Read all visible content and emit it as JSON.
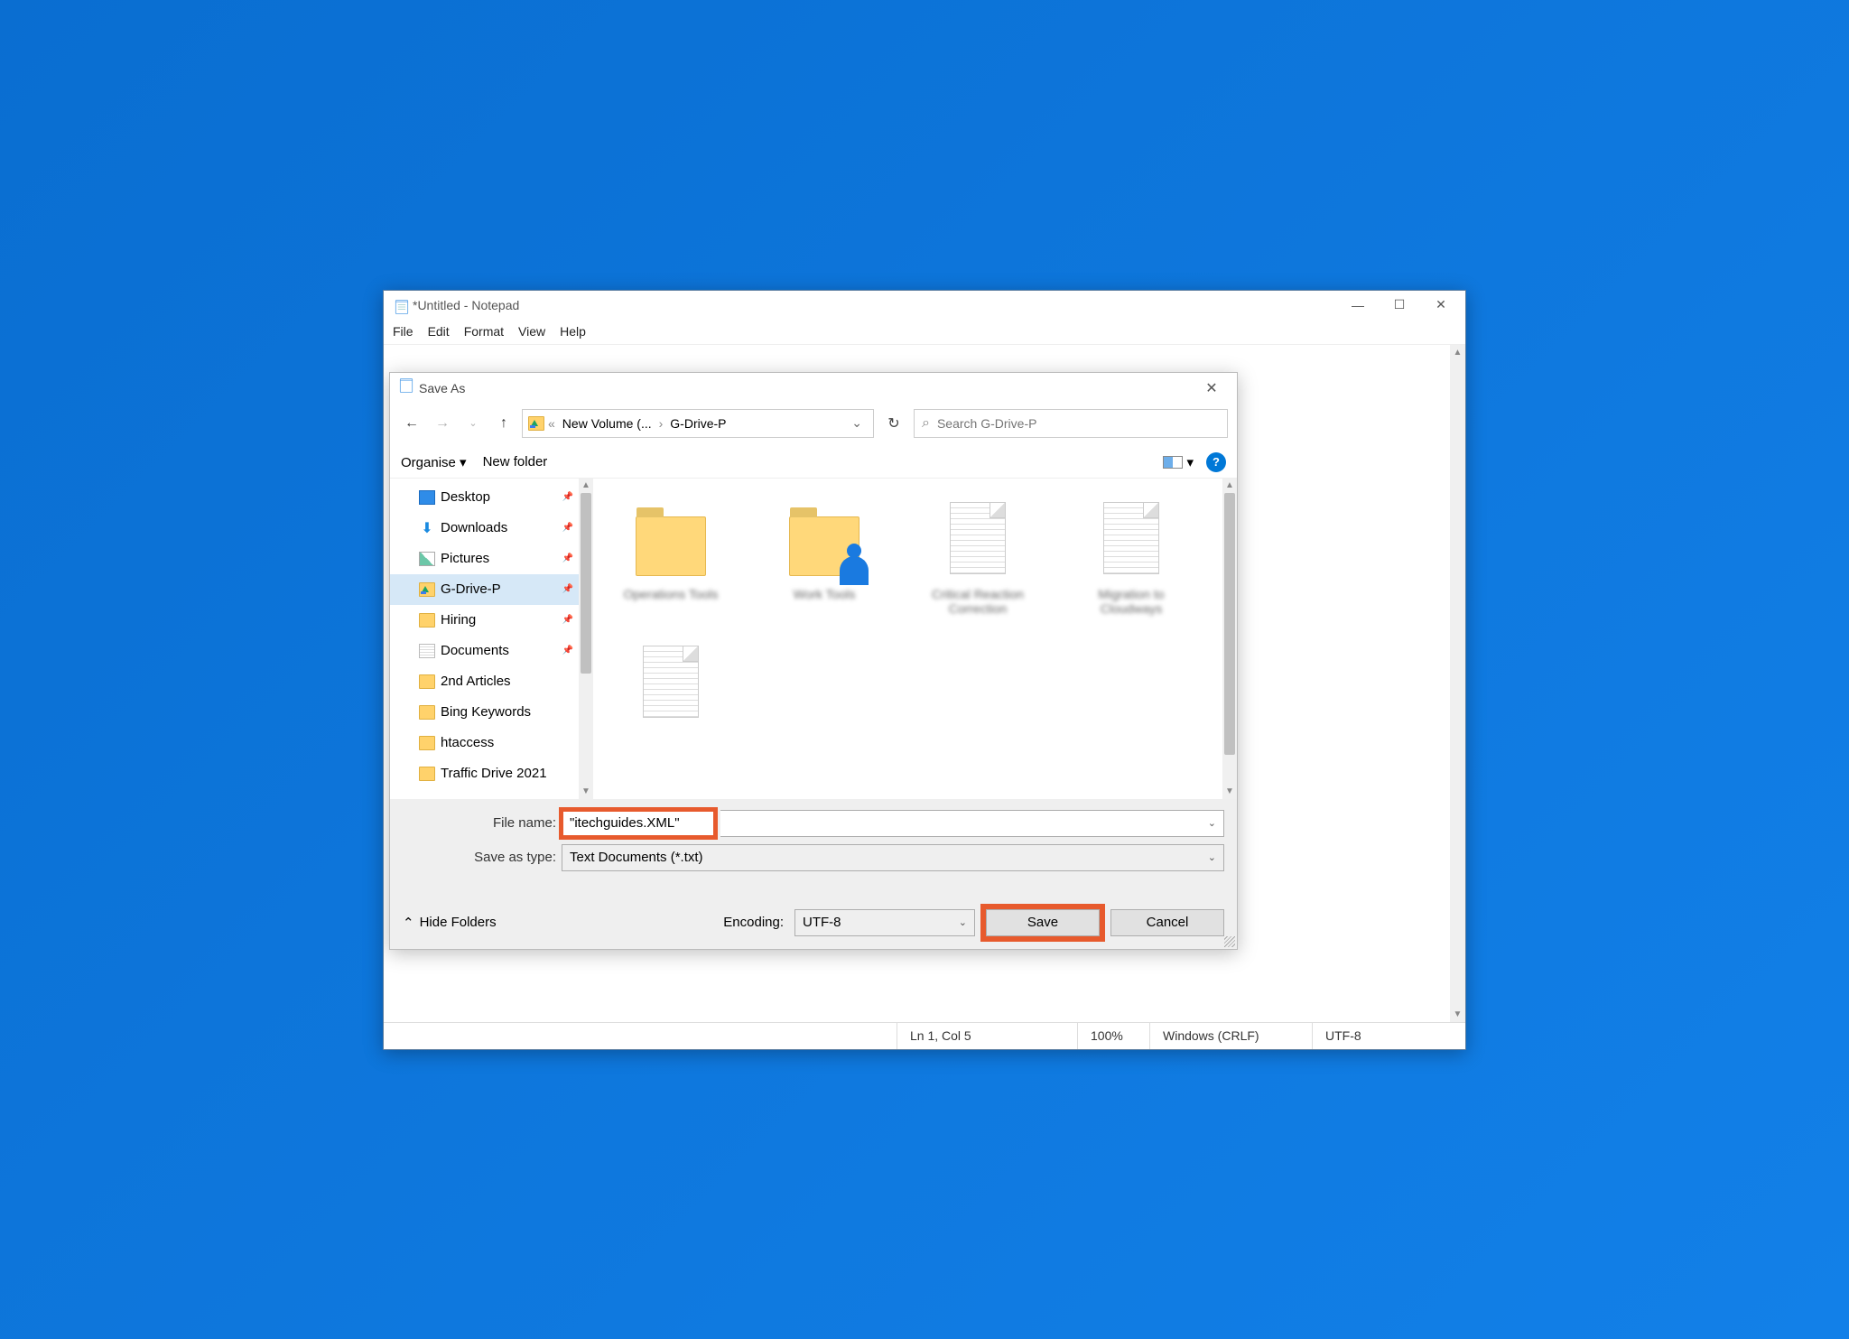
{
  "window": {
    "title": "*Untitled - Notepad",
    "menu": {
      "file": "File",
      "edit": "Edit",
      "format": "Format",
      "view": "View",
      "help": "Help"
    }
  },
  "dialog": {
    "title": "Save As",
    "breadcrumb": {
      "seg1": "New Volume (...",
      "seg2": "G-Drive-P"
    },
    "search_placeholder": "Search G-Drive-P",
    "toolbar": {
      "organise": "Organise",
      "new_folder": "New folder"
    },
    "tree": {
      "desktop": "Desktop",
      "downloads": "Downloads",
      "pictures": "Pictures",
      "gdrivep": "G-Drive-P",
      "hiring": "Hiring",
      "documents": "Documents",
      "second_articles": "2nd Articles",
      "bing_keywords": "Bing Keywords",
      "htaccess": "htaccess",
      "traffic_drive": "Traffic Drive 2021"
    },
    "files": {
      "f1": "Operations Tools",
      "f2": "Work Tools",
      "f3": "Critical Reaction Correction",
      "f4": "Migration to Cloudways",
      "f5": " "
    },
    "form": {
      "filename_label": "File name:",
      "filename_value": "\"itechguides.XML\"",
      "type_label": "Save as type:",
      "type_value": "Text Documents (*.txt)"
    },
    "footer": {
      "hide_folders": "Hide Folders",
      "encoding_label": "Encoding:",
      "encoding_value": "UTF-8",
      "save": "Save",
      "cancel": "Cancel"
    }
  },
  "status": {
    "position": "Ln 1, Col 5",
    "zoom": "100%",
    "line_ending": "Windows (CRLF)",
    "encoding": "UTF-8"
  }
}
